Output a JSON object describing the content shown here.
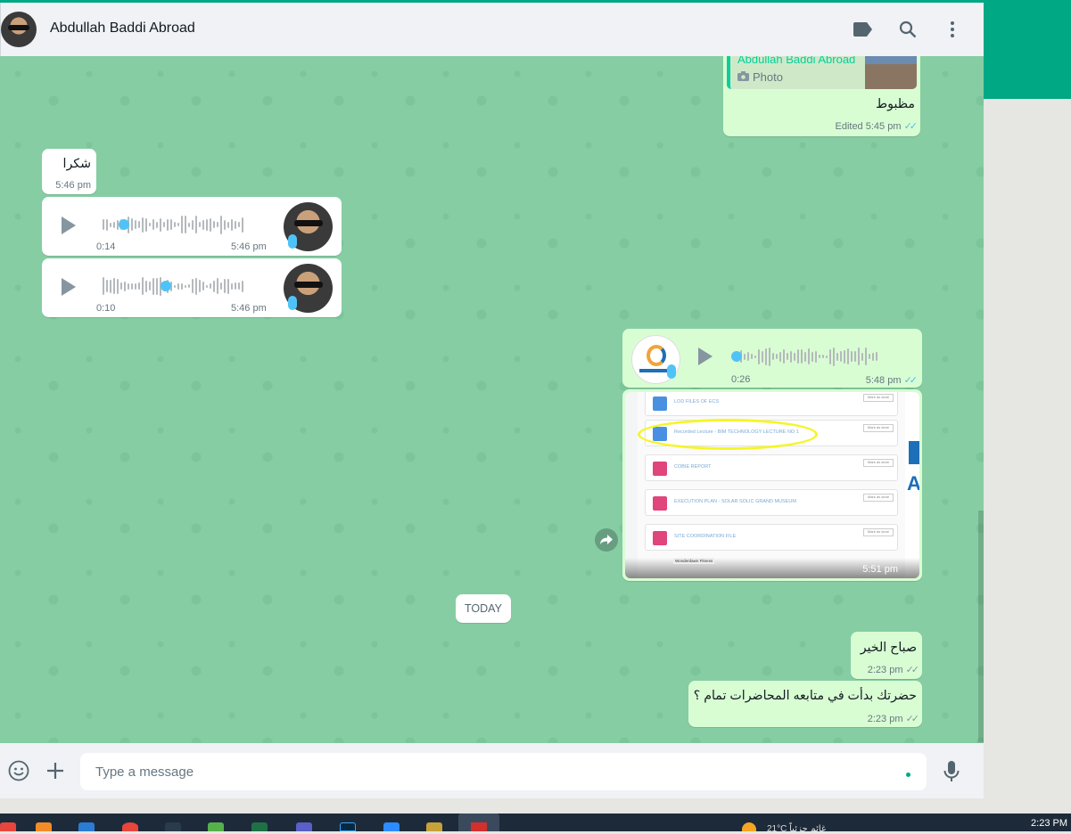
{
  "header": {
    "contact_name": "Abdullah Baddi Abroad",
    "icons": [
      "label-icon",
      "search-icon",
      "menu-icon"
    ]
  },
  "messages": {
    "quoted_reply": {
      "name": "Abdullah Baddi Abroad",
      "type_label": "Photo",
      "text": "مظبوط",
      "edited_label": "Edited",
      "time": "5:45 pm"
    },
    "shukran": {
      "text": "شكرا",
      "time": "5:46 pm"
    },
    "voice1": {
      "duration": "0:14",
      "time": "5:46 pm",
      "progress": 0.15
    },
    "voice2": {
      "duration": "0:10",
      "time": "5:46 pm",
      "progress": 0.45
    },
    "voice_out": {
      "duration": "0:26",
      "time": "5:48 pm",
      "progress": 0.0
    },
    "image_out": {
      "time": "5:51 pm",
      "rows": [
        "LOD FILES OF ECS",
        "Recorded Lecture - BIM TECHNOLOGY LECTURE NO 1",
        "COBIE REPORT",
        "EXECUTION PLAN - SOLAR SOLIC GRAND MUSEUM",
        "SITE COORDINATION FILE"
      ],
      "mark_label": "Mark as done",
      "bottom_label": "Wonderdawn Fitness"
    },
    "today_label": "TODAY",
    "morning": {
      "text": "صباح الخير",
      "time": "2:23 pm"
    },
    "question": {
      "text": "حضرتك بدأت في متابعه المحاضرات تمام ؟",
      "time": "2:23 pm"
    }
  },
  "footer": {
    "placeholder": "Type a message"
  },
  "taskbar": {
    "clock": "2:23 PM",
    "weather": "21°C",
    "weather_tail": "غائم جزئياً"
  },
  "colors": {
    "accent": "#00a884",
    "chat_bg": "#86cda3",
    "outgoing": "#d9fdd3",
    "read_ticks": "#53bdeb"
  }
}
